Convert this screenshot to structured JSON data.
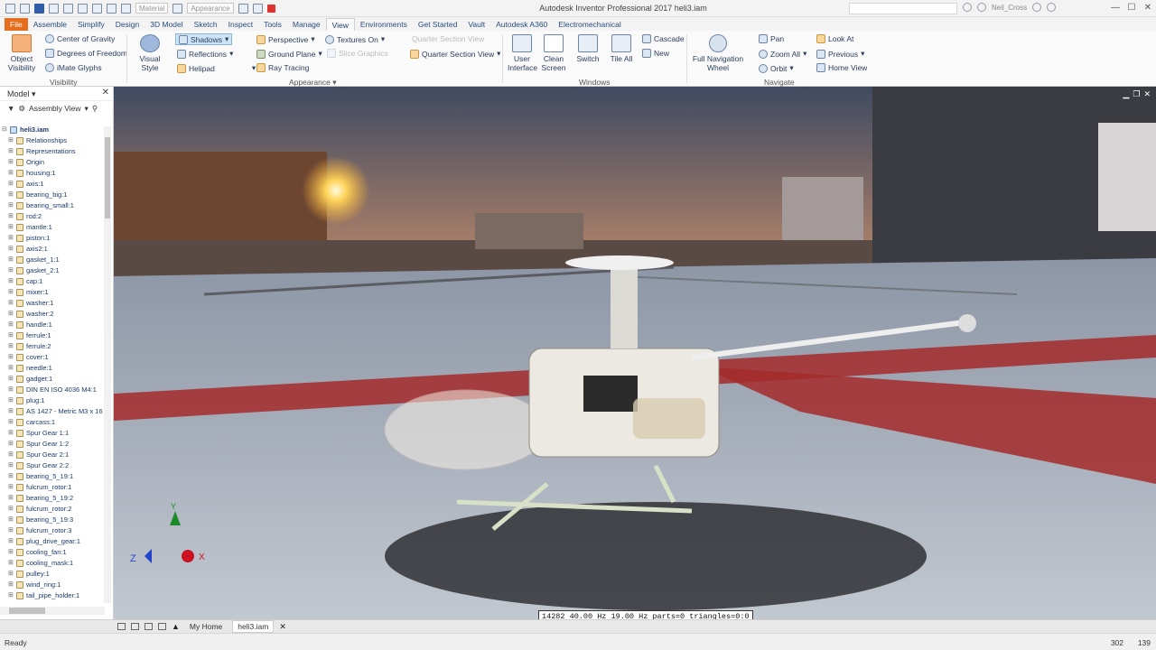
{
  "app": {
    "title": "Autodesk Inventor Professional 2017   heli3.iam",
    "material_combo": "Material",
    "appearance_combo": "Appearance",
    "user_name": "Neil_Cross"
  },
  "tabs": [
    "File",
    "Assemble",
    "Simplify",
    "Design",
    "3D Model",
    "Sketch",
    "Inspect",
    "Tools",
    "Manage",
    "View",
    "Environments",
    "Get Started",
    "Vault",
    "Autodesk A360",
    "Electromechanical"
  ],
  "active_tab": "View",
  "ribbon": {
    "visibility": {
      "object_visibility": "Object Visibility",
      "center_of_gravity": "Center of Gravity",
      "degrees_of_freedom": "Degrees of Freedom",
      "imate_glyphs": "iMate Glyphs",
      "group_label": "Visibility"
    },
    "appearance": {
      "visual_style": "Visual Style",
      "shadows": "Shadows",
      "reflections": "Reflections",
      "helipad": "Helipad",
      "perspective": "Perspective",
      "ground_plane": "Ground Plane",
      "ray_tracing": "Ray Tracing",
      "textures_on": "Textures On",
      "slice_graphics": "Slice Graphics",
      "section_view_disabled": "Quarter Section View",
      "quarter_section_view": "Quarter Section View",
      "group_label": "Appearance"
    },
    "windows": {
      "user_interface": "User Interface",
      "clean_screen": "Clean Screen",
      "switch": "Switch",
      "tile_all": "Tile All",
      "cascade": "Cascade",
      "new": "New",
      "group_label": "Windows"
    },
    "navigate": {
      "full_navigation_wheel": "Full Navigation Wheel",
      "pan": "Pan",
      "zoom_all": "Zoom All",
      "orbit": "Orbit",
      "look_at": "Look At",
      "previous": "Previous",
      "home_view": "Home View",
      "group_label": "Navigate"
    }
  },
  "browser": {
    "title": "Model",
    "view_mode": "Assembly View",
    "root": "heli3.iam",
    "items": [
      "Relationships",
      "Representations",
      "Origin",
      "housing:1",
      "axis:1",
      "bearing_big:1",
      "bearing_small:1",
      "rod:2",
      "mantle:1",
      "piston:1",
      "axis2:1",
      "gasket_1:1",
      "gasket_2:1",
      "cap:1",
      "mixer:1",
      "washer:1",
      "washer:2",
      "handle:1",
      "ferrule:1",
      "ferrule:2",
      "cover:1",
      "needle:1",
      "gadget:1",
      "DIN EN ISO 4036 M4:1",
      "plug:1",
      "AS 1427 - Metric M3 x 16",
      "carcass:1",
      "Spur Gear 1:1",
      "Spur Gear 1:2",
      "Spur Gear 2:1",
      "Spur Gear 2:2",
      "bearing_5_19:1",
      "fulcrum_rotor:1",
      "bearing_5_19:2",
      "fulcrum_rotor:2",
      "bearing_5_19:3",
      "fulcrum_rotor:3",
      "plug_drive_gear:1",
      "cooling_fan:1",
      "cooling_mask:1",
      "pulley:1",
      "wind_ring:1",
      "tail_pipe_holder:1"
    ]
  },
  "viewport": {
    "perf_text": "14282  40.00 Hz  19.00 Hz  parts=0 triangles=0:0",
    "triad": {
      "x": "X",
      "y": "Y",
      "z": "Z"
    }
  },
  "doc_tabs": {
    "home": "My Home",
    "active": "heli3.iam"
  },
  "status": {
    "text": "Ready",
    "count1": "302",
    "count2": "139"
  },
  "colors": {
    "file_tab": "#e66c1e",
    "sky_top": "#3f4a61",
    "sunset": "#f2a03a",
    "helipad_red": "#a42a2a"
  }
}
